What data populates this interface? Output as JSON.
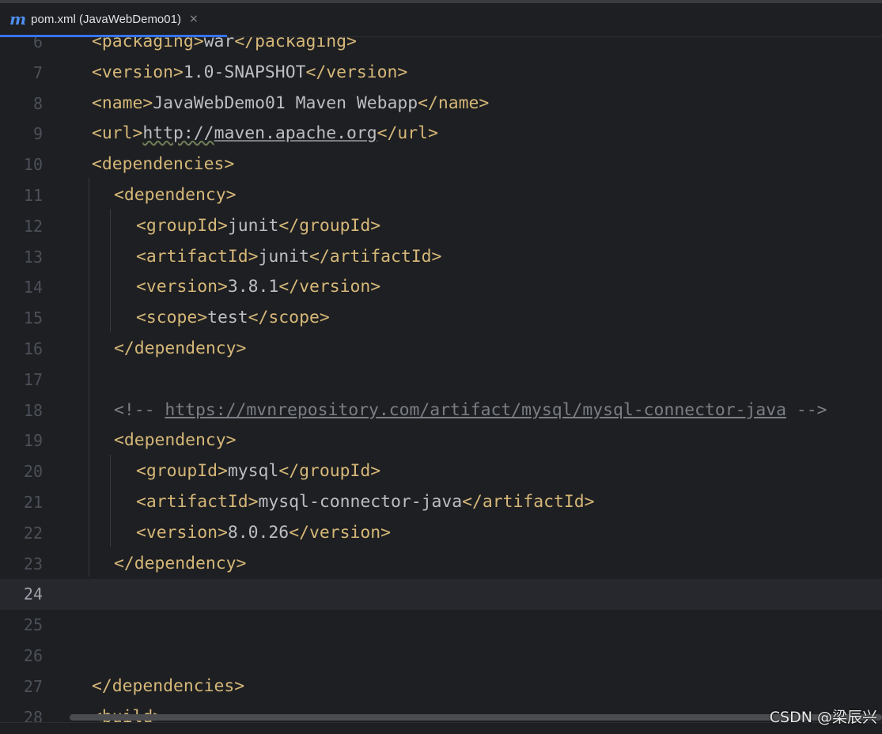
{
  "tab": {
    "icon": "m",
    "title": "pom.xml (JavaWebDemo01)",
    "close": "×"
  },
  "editor": {
    "current_line": 24,
    "lines": [
      {
        "n": "6",
        "indent": 0,
        "parts": [
          [
            "tag",
            "<packaging>"
          ],
          [
            "txt",
            "war"
          ],
          [
            "tag",
            "</packaging>"
          ]
        ]
      },
      {
        "n": "7",
        "indent": 0,
        "parts": [
          [
            "tag",
            "<version>"
          ],
          [
            "txt",
            "1.0-SNAPSHOT"
          ],
          [
            "tag",
            "</version>"
          ]
        ]
      },
      {
        "n": "8",
        "indent": 0,
        "parts": [
          [
            "tag",
            "<name>"
          ],
          [
            "txt",
            "JavaWebDemo01 Maven Webapp"
          ],
          [
            "tag",
            "</name>"
          ]
        ]
      },
      {
        "n": "9",
        "indent": 0,
        "parts": [
          [
            "tag",
            "<url>"
          ],
          [
            "wavy",
            "http://"
          ],
          [
            "url",
            "maven.apache.org"
          ],
          [
            "tag",
            "</url>"
          ]
        ]
      },
      {
        "n": "10",
        "indent": 0,
        "parts": [
          [
            "tag",
            "<dependencies>"
          ]
        ]
      },
      {
        "n": "11",
        "indent": 1,
        "parts": [
          [
            "tag",
            "<dependency>"
          ]
        ]
      },
      {
        "n": "12",
        "indent": 2,
        "parts": [
          [
            "tag",
            "<groupId>"
          ],
          [
            "txt",
            "junit"
          ],
          [
            "tag",
            "</groupId>"
          ]
        ]
      },
      {
        "n": "13",
        "indent": 2,
        "parts": [
          [
            "tag",
            "<artifactId>"
          ],
          [
            "txt",
            "junit"
          ],
          [
            "tag",
            "</artifactId>"
          ]
        ]
      },
      {
        "n": "14",
        "indent": 2,
        "parts": [
          [
            "tag",
            "<version>"
          ],
          [
            "txt",
            "3.8.1"
          ],
          [
            "tag",
            "</version>"
          ]
        ]
      },
      {
        "n": "15",
        "indent": 2,
        "parts": [
          [
            "tag",
            "<scope>"
          ],
          [
            "txt",
            "test"
          ],
          [
            "tag",
            "</scope>"
          ]
        ]
      },
      {
        "n": "16",
        "indent": 1,
        "parts": [
          [
            "tag",
            "</dependency>"
          ]
        ]
      },
      {
        "n": "17",
        "indent": 0,
        "parts": []
      },
      {
        "n": "18",
        "indent": 1,
        "parts": [
          [
            "cmt",
            "<!-- "
          ],
          [
            "cmturl",
            "https://mvnrepository.com/artifact/mysql/mysql-connector-java"
          ],
          [
            "cmt",
            " -->"
          ]
        ]
      },
      {
        "n": "19",
        "indent": 1,
        "parts": [
          [
            "tag",
            "<dependency>"
          ]
        ]
      },
      {
        "n": "20",
        "indent": 2,
        "parts": [
          [
            "tag",
            "<groupId>"
          ],
          [
            "txt",
            "mysql"
          ],
          [
            "tag",
            "</groupId>"
          ]
        ]
      },
      {
        "n": "21",
        "indent": 2,
        "parts": [
          [
            "tag",
            "<artifactId>"
          ],
          [
            "txt",
            "mysql-connector-java"
          ],
          [
            "tag",
            "</artifactId>"
          ]
        ]
      },
      {
        "n": "22",
        "indent": 2,
        "parts": [
          [
            "tag",
            "<version>"
          ],
          [
            "txt",
            "8.0.26"
          ],
          [
            "tag",
            "</version>"
          ]
        ]
      },
      {
        "n": "23",
        "indent": 1,
        "parts": [
          [
            "tag",
            "</dependency>"
          ]
        ]
      },
      {
        "n": "24",
        "indent": 0,
        "parts": []
      },
      {
        "n": "25",
        "indent": 0,
        "parts": []
      },
      {
        "n": "26",
        "indent": 0,
        "parts": []
      },
      {
        "n": "27",
        "indent": 0,
        "parts": [
          [
            "tag",
            "</dependencies>"
          ]
        ]
      },
      {
        "n": "28",
        "indent": 0,
        "parts": [
          [
            "tag",
            "<build>"
          ]
        ]
      }
    ]
  },
  "watermark": "CSDN @梁辰兴",
  "colors": {
    "background": "#1e1f22",
    "tag": "#d5b778",
    "text": "#bcbec4",
    "comment": "#7a7e85",
    "line_number": "#4b5059",
    "accent": "#3574f0"
  }
}
